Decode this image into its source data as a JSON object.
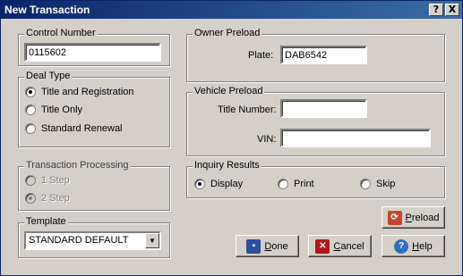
{
  "window": {
    "title": "New Transaction",
    "help_glyph": "?",
    "close_glyph": "X"
  },
  "control_number": {
    "legend": "Control Number",
    "value": "0115602"
  },
  "deal_type": {
    "legend": "Deal Type",
    "options": [
      {
        "label": "Title and Registration",
        "selected": true
      },
      {
        "label": "Title Only",
        "selected": false
      },
      {
        "label": "Standard Renewal",
        "selected": false
      }
    ]
  },
  "transaction_processing": {
    "legend": "Transaction Processing",
    "options": [
      {
        "label": "1 Step",
        "selected": false
      },
      {
        "label": "2 Step",
        "selected": true
      }
    ]
  },
  "template": {
    "legend": "Template",
    "selected": "STANDARD DEFAULT"
  },
  "owner_preload": {
    "legend": "Owner Preload",
    "plate_label": "Plate:",
    "plate_value": "DAB6542"
  },
  "vehicle_preload": {
    "legend": "Vehicle Preload",
    "title_number_label": "Title Number:",
    "title_number_value": "",
    "vin_label": "VIN:",
    "vin_value": ""
  },
  "inquiry_results": {
    "legend": "Inquiry Results",
    "options": [
      {
        "label": "Display",
        "selected": true
      },
      {
        "label": "Print",
        "selected": false
      },
      {
        "label": "Skip",
        "selected": false
      }
    ]
  },
  "buttons": {
    "preload_first": "P",
    "preload_rest": "reload",
    "done_first": "D",
    "done_rest": "one",
    "cancel_first": "C",
    "cancel_rest": "ancel",
    "help_first": "H",
    "help_rest": "elp"
  },
  "colors": {
    "title_gradient_start": "#0a246a",
    "title_gradient_end": "#3a6ea5",
    "dialog_face": "#d4d0c8"
  }
}
